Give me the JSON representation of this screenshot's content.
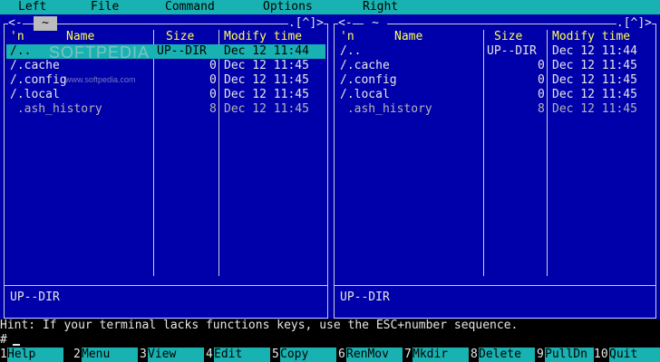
{
  "menubar": {
    "items": [
      "Left",
      "File",
      "Command",
      "Options",
      "Right"
    ]
  },
  "left_panel": {
    "path": "~",
    "left_bracket": "<-",
    "right_bracket": ".[^]>",
    "headers": {
      "n": "'n",
      "name": "Name",
      "size": "Size",
      "mtime": "Modify time"
    },
    "rows": [
      {
        "name": "/..",
        "size": "UP--DIR",
        "mtime": "Dec 12 11:44",
        "selected": true
      },
      {
        "name": "/.cache",
        "size": "0",
        "mtime": "Dec 12 11:45"
      },
      {
        "name": "/.config",
        "size": "0",
        "mtime": "Dec 12 11:45"
      },
      {
        "name": "/.local",
        "size": "0",
        "mtime": "Dec 12 11:45"
      },
      {
        "name": " .ash_history",
        "size": "8",
        "mtime": "Dec 12 11:45"
      }
    ],
    "status": "UP--DIR"
  },
  "right_panel": {
    "path": "~",
    "left_bracket": "<-",
    "right_bracket": ".[^]>",
    "headers": {
      "n": "'n",
      "name": "Name",
      "size": "Size",
      "mtime": "Modify time"
    },
    "rows": [
      {
        "name": "/..",
        "size": "UP--DIR",
        "mtime": "Dec 12 11:44"
      },
      {
        "name": "/.cache",
        "size": "0",
        "mtime": "Dec 12 11:45"
      },
      {
        "name": "/.config",
        "size": "0",
        "mtime": "Dec 12 11:45"
      },
      {
        "name": "/.local",
        "size": "0",
        "mtime": "Dec 12 11:45"
      },
      {
        "name": " .ash_history",
        "size": "8",
        "mtime": "Dec 12 11:45"
      }
    ],
    "status": "UP--DIR"
  },
  "hint": "Hint: If your terminal lacks functions keys, use the ESC+number sequence.",
  "prompt": "#",
  "fkeys": [
    {
      "num": "1",
      "label": "Help"
    },
    {
      "num": "2",
      "label": "Menu"
    },
    {
      "num": "3",
      "label": "View"
    },
    {
      "num": "4",
      "label": "Edit"
    },
    {
      "num": "5",
      "label": "Copy"
    },
    {
      "num": "6",
      "label": "RenMov"
    },
    {
      "num": "7",
      "label": "Mkdir"
    },
    {
      "num": "8",
      "label": "Delete"
    },
    {
      "num": "9",
      "label": "PullDn"
    },
    {
      "num": "10",
      "label": "Quit"
    }
  ],
  "watermark": {
    "brand": "SOFTPEDIA",
    "url": "www.softpedia.com"
  },
  "colors": {
    "panel_bg": "#0000aa",
    "bar": "#19b2b2",
    "header": "#ffff55",
    "text": "#e6e6e6"
  }
}
